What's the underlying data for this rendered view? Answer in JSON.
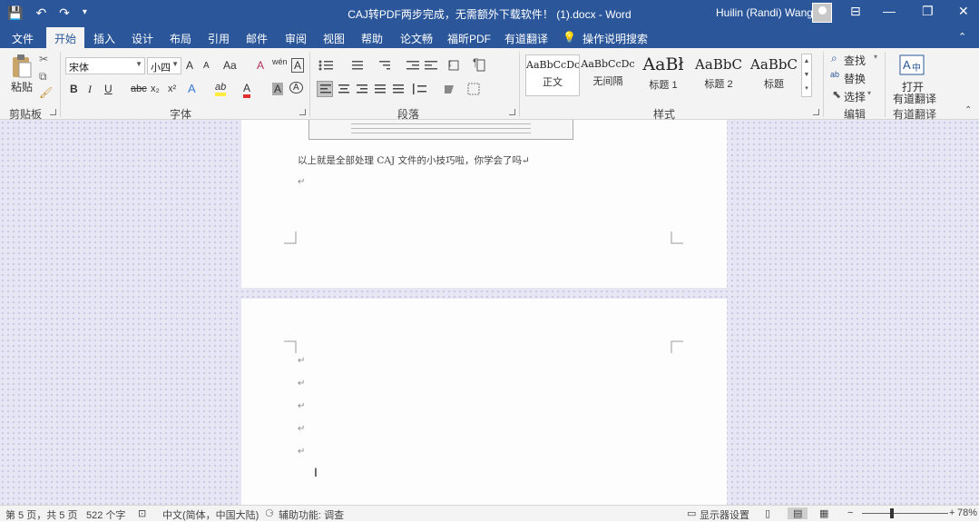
{
  "window": {
    "doc_title": "CAJ转PDF两步完成，无需额外下载软件！ (1).docx - Word",
    "user_name": "Huilin (Randi) Wang",
    "qat": {
      "save_icon": "💾",
      "undo_icon": "↶",
      "redo_icon": "↷",
      "customize_icon": "▾"
    },
    "window_buttons": {
      "ribbon_display": "⊟",
      "minimize": "—",
      "restore": "❐",
      "close": "✕"
    }
  },
  "tabs": [
    "文件",
    "开始",
    "插入",
    "设计",
    "布局",
    "引用",
    "邮件",
    "审阅",
    "视图",
    "帮助",
    "论文畅",
    "福昕PDF",
    "有道翻译"
  ],
  "active_tab": "开始",
  "tell_me": {
    "icon": "💡",
    "label": "操作说明搜索"
  },
  "ribbon": {
    "clipboard": {
      "label": "剪贴板",
      "paste": "粘贴"
    },
    "font": {
      "label": "字体",
      "font_name": "宋体",
      "font_size": "小四",
      "grow": "A",
      "shrink": "A",
      "case": "Aa",
      "clear": "A",
      "phonetic": "wén",
      "enclose": "A",
      "bold": "B",
      "italic": "I",
      "underline": "U",
      "strike": "abc",
      "sub": "x₂",
      "sup": "x²",
      "effects": "A",
      "highlight": "ab",
      "color": "A",
      "shade": "A",
      "char_border": "A"
    },
    "paragraph": {
      "label": "段落"
    },
    "styles": {
      "label": "样式",
      "items": [
        {
          "sample": "AaBbCcDc",
          "name": "正文"
        },
        {
          "sample": "AaBbCcDc",
          "name": "无间隔"
        },
        {
          "sample": "AaBł",
          "name": "标题 1"
        },
        {
          "sample": "AaBbC",
          "name": "标题 2"
        },
        {
          "sample": "AaBbC",
          "name": "标题"
        }
      ]
    },
    "editing": {
      "label": "编辑",
      "find": "查找",
      "replace": "替换",
      "select": "选择"
    },
    "youdao": {
      "label": "有道翻译",
      "open_line1": "打开",
      "open_line2": "有道翻译"
    }
  },
  "document": {
    "paragraph_text": "以上就是全部处理 CAJ 文件的小技巧啦，你学会了吗↵",
    "para_mark": "↵"
  },
  "status": {
    "page": "第 5 页，共 5 页",
    "words": "522 个字",
    "language": "中文(简体，中国大陆)",
    "accessibility": "辅助功能: 调查",
    "display_settings": "显示器设置",
    "zoom_minus": "−",
    "zoom_plus": "+",
    "zoom": "78%"
  }
}
